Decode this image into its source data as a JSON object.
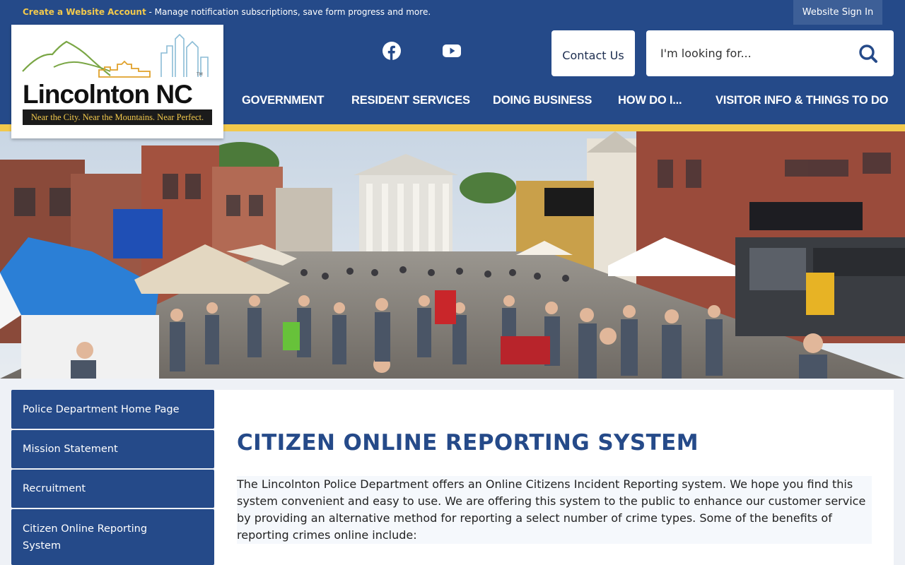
{
  "topbar": {
    "create_link": "Create a Website Account",
    "message": " - Manage notification subscriptions, save form progress and more.",
    "signin_label": "Website Sign In"
  },
  "logo": {
    "name": "Lincolnton NC",
    "tagline": "Near the City. Near the Mountains. Near Perfect."
  },
  "social": [
    "facebook-icon",
    "youtube-icon"
  ],
  "header": {
    "contact_label": "Contact Us",
    "search_placeholder": "I'm looking for..."
  },
  "nav": {
    "items": [
      {
        "label": "GOVERNMENT"
      },
      {
        "label": "RESIDENT SERVICES"
      },
      {
        "label": "DOING BUSINESS"
      },
      {
        "label": "HOW DO I..."
      },
      {
        "label": "VISITOR INFO & THINGS TO DO"
      }
    ]
  },
  "sidebar": {
    "items": [
      {
        "label": "Police Department Home Page"
      },
      {
        "label": "Mission Statement"
      },
      {
        "label": "Recruitment"
      },
      {
        "label": "Citizen Online Reporting System"
      }
    ]
  },
  "main": {
    "title": "CITIZEN ONLINE REPORTING SYSTEM",
    "intro": "The Lincolnton Police Department offers an Online Citizens Incident Reporting system. We hope you find this system convenient and easy to use. We are offering this system to the public to enhance our customer service by providing an alternative method for reporting a select number of crime types. Some of the benefits of reporting crimes online include:"
  },
  "colors": {
    "brand_blue": "#254a89",
    "accent_gold": "#f2c94c"
  }
}
